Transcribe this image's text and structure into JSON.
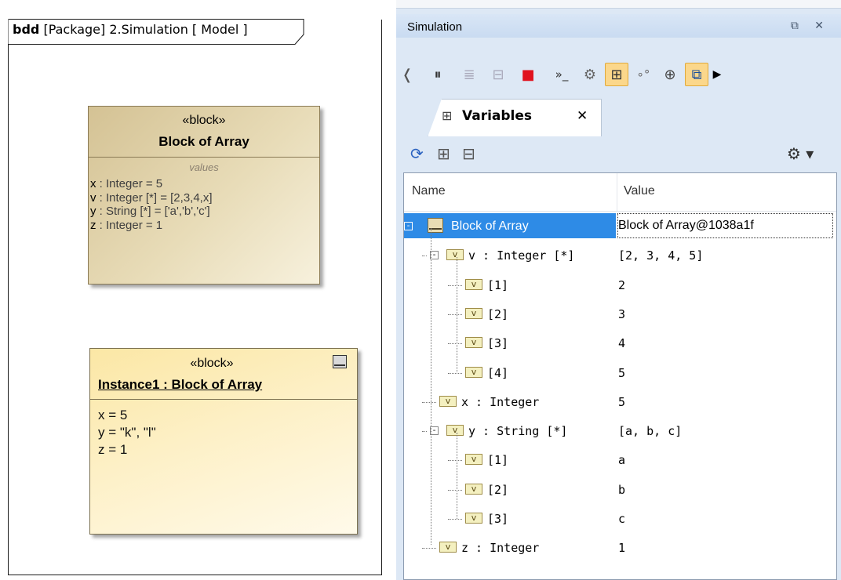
{
  "diagram": {
    "frame_title_kind": "bdd",
    "frame_title_rest": " [Package] 2.Simulation [ Model ]",
    "block": {
      "stereotype": "«block»",
      "name": "Block of Array",
      "compartment_label": "values",
      "values": [
        {
          "name": "x",
          "rest": " : Integer = 5"
        },
        {
          "name": "v",
          "rest": " : Integer [*] = [2,3,4,x]"
        },
        {
          "name": "y",
          "rest": " : String [*] = ['a','b','c']"
        },
        {
          "name": "z",
          "rest": " : Integer = 1"
        }
      ]
    },
    "instance": {
      "stereotype": "«block»",
      "name": "Instance1 : Block of Array",
      "slots": [
        "x = 5",
        "y = \"k\", \"l\"",
        "z = 1"
      ]
    }
  },
  "panel": {
    "title": "Simulation",
    "controls": "⧉ ✕",
    "toolbar": {
      "buttons": [
        {
          "name": "step-back-button",
          "glyph": "❬",
          "icon": "step-back-icon"
        },
        {
          "name": "pause-button",
          "glyph": "⏸",
          "icon": "pause-icon"
        },
        {
          "name": "step-into-button",
          "glyph": "≣",
          "icon": "step-into-icon"
        },
        {
          "name": "step-over-button",
          "glyph": "⊟",
          "icon": "step-over-icon"
        },
        {
          "name": "terminate-button",
          "glyph": "■",
          "icon": "stop-icon"
        },
        {
          "name": "console-button",
          "glyph": "»_",
          "icon": "console-icon"
        },
        {
          "name": "breakpoints-button",
          "glyph": "⚙",
          "icon": "breakpoints-icon"
        },
        {
          "name": "variables-view-button",
          "glyph": "⊞",
          "icon": "variables-icon"
        },
        {
          "name": "sessions-view-button",
          "glyph": "∘°",
          "icon": "sessions-icon"
        },
        {
          "name": "lock-button",
          "glyph": "⊕",
          "icon": "lock-icon"
        },
        {
          "name": "triggers-view-button",
          "glyph": "⧉",
          "icon": "triggers-icon"
        },
        {
          "name": "more-button",
          "glyph": "▶",
          "icon": "more-icon"
        }
      ]
    },
    "tab": {
      "label": "Variables",
      "icon": "⊞",
      "close": "✕"
    },
    "variables_toolbar": {
      "refresh": "⟳",
      "expand": "⊞",
      "collapse": "⊟",
      "options": "⚙ ▾"
    },
    "tree": {
      "headers": {
        "name": "Name",
        "value": "Value"
      },
      "rows": [
        {
          "level": 0,
          "label": "Block of Array",
          "value": "Block of Array@1038a1f",
          "icon": "block",
          "expander": "-",
          "selected": true
        },
        {
          "level": 1,
          "label": "v : Integer [*]",
          "value": "[2, 3, 4, 5]",
          "icon": "v",
          "expander": "-"
        },
        {
          "level": 2,
          "label": "[1]",
          "value": "2",
          "icon": "v"
        },
        {
          "level": 2,
          "label": "[2]",
          "value": "3",
          "icon": "v"
        },
        {
          "level": 2,
          "label": "[3]",
          "value": "4",
          "icon": "v"
        },
        {
          "level": 2,
          "label": "[4]",
          "value": "5",
          "icon": "v",
          "last": true
        },
        {
          "level": 1,
          "label": "x : Integer",
          "value": "5",
          "icon": "v"
        },
        {
          "level": 1,
          "label": "y : String [*]",
          "value": "[a, b, c]",
          "icon": "v",
          "expander": "-"
        },
        {
          "level": 2,
          "label": "[1]",
          "value": "a",
          "icon": "v"
        },
        {
          "level": 2,
          "label": "[2]",
          "value": "b",
          "icon": "v"
        },
        {
          "level": 2,
          "label": "[3]",
          "value": "c",
          "icon": "v",
          "last": true
        },
        {
          "level": 1,
          "label": "z : Integer",
          "value": "1",
          "icon": "v",
          "last": true
        }
      ]
    },
    "colors": {
      "selection": "#2e8be6",
      "active_button": "#fbd78b",
      "panel_bg": "#dde8f5"
    }
  }
}
